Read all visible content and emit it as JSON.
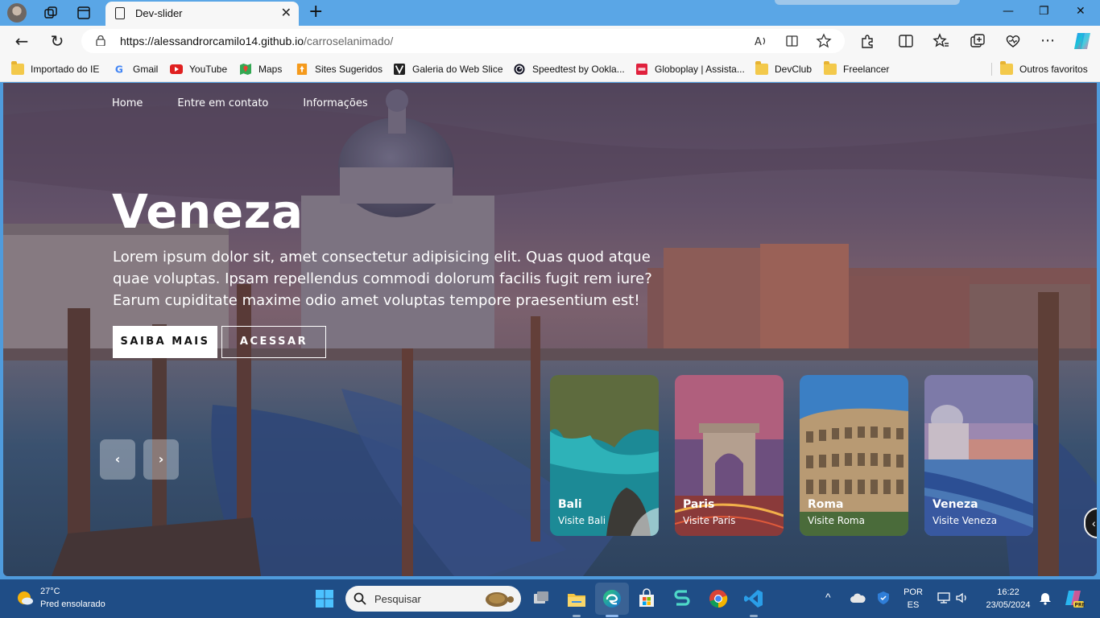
{
  "browser": {
    "tab_title": "Dev-slider",
    "url_host": "https://alessandrorcamilo14.github.io",
    "url_path": "/carroselanimado/",
    "bookmarks": [
      {
        "label": "Importado do IE",
        "icon": "folder-icon"
      },
      {
        "label": "Gmail",
        "icon": "google-icon"
      },
      {
        "label": "YouTube",
        "icon": "youtube-icon"
      },
      {
        "label": "Maps",
        "icon": "maps-icon"
      },
      {
        "label": "Sites Sugeridos",
        "icon": "sites-icon"
      },
      {
        "label": "Galeria do Web Slice",
        "icon": "webslice-icon"
      },
      {
        "label": "Speedtest by Ookla...",
        "icon": "speedtest-icon"
      },
      {
        "label": "Globoplay | Assista...",
        "icon": "globoplay-icon"
      },
      {
        "label": "DevClub",
        "icon": "folder-icon"
      },
      {
        "label": "Freelancer",
        "icon": "folder-icon"
      }
    ],
    "other_favorites": "Outros favoritos"
  },
  "site": {
    "menu": [
      "Home",
      "Entre em contato",
      "Informações"
    ],
    "hero_title": "Veneza",
    "hero_text": "Lorem ipsum dolor sit, amet consectetur adipisicing elit. Quas quod atque quae voluptas. Ipsam repellendus commodi dolorum facilis fugit rem iure? Earum cupiditate maxime odio amet voluptas tempore praesentium est!",
    "btn_primary": "SAIBA MAIS",
    "btn_secondary": "ACESSAR",
    "prev_arrow": "‹",
    "next_arrow": "›",
    "cards": [
      {
        "title": "Bali",
        "subtitle": "Visite Bali"
      },
      {
        "title": "Paris",
        "subtitle": "Visite Paris"
      },
      {
        "title": "Roma",
        "subtitle": "Visite Roma"
      },
      {
        "title": "Veneza",
        "subtitle": "Visite Veneza"
      }
    ]
  },
  "taskbar": {
    "temperature": "27°C",
    "weather": "Pred ensolarado",
    "search_placeholder": "Pesquisar",
    "lang_line1": "POR",
    "lang_line2": "ES",
    "time": "16:22",
    "date": "23/05/2024"
  },
  "colors": {
    "titlebar": "#5aa6e6",
    "taskbar": "#1f4d86",
    "chrome": "#f7f7f7"
  }
}
